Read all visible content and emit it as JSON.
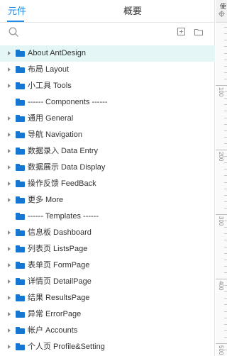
{
  "tabs": [
    {
      "label": "元件",
      "active": true
    },
    {
      "label": "概要",
      "active": false
    }
  ],
  "toolbar": {
    "search_icon": "search-icon",
    "add_page_icon": "add-page-icon",
    "add_folder_icon": "add-folder-icon"
  },
  "items": [
    {
      "label": "About AntDesign",
      "expandable": true,
      "selected": true
    },
    {
      "label": "布局 Layout",
      "expandable": true,
      "selected": false
    },
    {
      "label": "小工具 Tools",
      "expandable": true,
      "selected": false
    },
    {
      "label": "------ Components ------",
      "expandable": false,
      "selected": false
    },
    {
      "label": "通用 General",
      "expandable": true,
      "selected": false
    },
    {
      "label": "导航 Navigation",
      "expandable": true,
      "selected": false
    },
    {
      "label": "数据录入 Data Entry",
      "expandable": true,
      "selected": false
    },
    {
      "label": "数据展示 Data Display",
      "expandable": true,
      "selected": false
    },
    {
      "label": "操作反馈 FeedBack",
      "expandable": true,
      "selected": false
    },
    {
      "label": "更多 More",
      "expandable": true,
      "selected": false
    },
    {
      "label": "------ Templates ------",
      "expandable": false,
      "selected": false
    },
    {
      "label": "信息板 Dashboard",
      "expandable": true,
      "selected": false
    },
    {
      "label": "列表页 ListsPage",
      "expandable": true,
      "selected": false
    },
    {
      "label": "表单页 FormPage",
      "expandable": true,
      "selected": false
    },
    {
      "label": "详情页 DetailPage",
      "expandable": true,
      "selected": false
    },
    {
      "label": "结果 ResultsPage",
      "expandable": true,
      "selected": false
    },
    {
      "label": "异常 ErrorPage",
      "expandable": true,
      "selected": false
    },
    {
      "label": "帐户 Accounts",
      "expandable": true,
      "selected": false
    },
    {
      "label": "个人页 Profile&Setting",
      "expandable": true,
      "selected": false
    }
  ],
  "ruler": {
    "title": "使",
    "crosshair_icon": "crosshair-icon",
    "labels": [
      "100",
      "200",
      "300",
      "400",
      "500"
    ]
  },
  "colors": {
    "accent": "#1e8ae8",
    "folder": "#1677d3",
    "selected_row": "#e5f6f6"
  }
}
